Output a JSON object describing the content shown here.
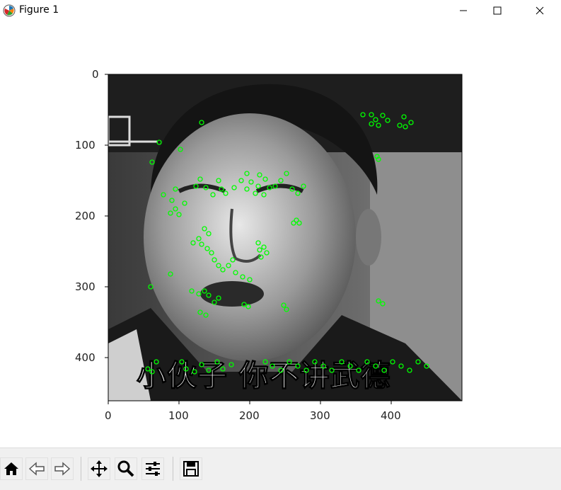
{
  "window": {
    "title": "Figure 1",
    "minimize_icon": "minimize-icon",
    "maximize_icon": "maximize-icon",
    "close_icon": "close-icon"
  },
  "plot": {
    "x_ticks": [
      "0",
      "100",
      "200",
      "300",
      "400"
    ],
    "y_ticks": [
      "0",
      "100",
      "200",
      "300",
      "400"
    ],
    "image_caption": "小伙子 你不讲武德",
    "keypoint_color": "#00ff00"
  },
  "toolbar": {
    "buttons": [
      {
        "name": "home-icon"
      },
      {
        "name": "back-icon"
      },
      {
        "name": "forward-icon"
      },
      {
        "name": "pan-icon"
      },
      {
        "name": "zoom-icon"
      },
      {
        "name": "configure-subplots-icon"
      },
      {
        "name": "save-icon"
      }
    ]
  }
}
